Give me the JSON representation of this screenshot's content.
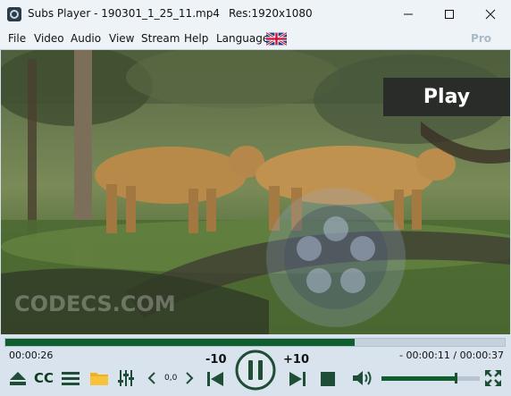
{
  "window": {
    "title": "Subs Player - 190301_1_25_11.mp4",
    "resolution": "Res:1920x1080"
  },
  "menu": {
    "items": [
      "File",
      "Video",
      "Audio",
      "View",
      "Stream",
      "Help",
      "Language"
    ],
    "pro_label": "Pro"
  },
  "video": {
    "play_banner": "Play",
    "watermark": "CODECS.COM"
  },
  "playback": {
    "elapsed": "00:00:26",
    "remaining": "- 00:00:11 / 00:00:37",
    "progress_fraction": 0.7,
    "speed": "0,0",
    "skip_back": "-10",
    "skip_forward": "+10",
    "cc_label": "CC",
    "volume_fraction": 0.75
  },
  "colors": {
    "accent": "#0f5f2e",
    "icon": "#1f4e36"
  },
  "icons": [
    "eject-icon",
    "cc-icon",
    "playlist-icon",
    "folder-icon",
    "equalizer-icon",
    "speed-down-icon",
    "speed-up-icon",
    "skip-back-icon",
    "pause-icon",
    "skip-forward-icon",
    "stop-icon",
    "volume-icon",
    "fullscreen-icon"
  ]
}
